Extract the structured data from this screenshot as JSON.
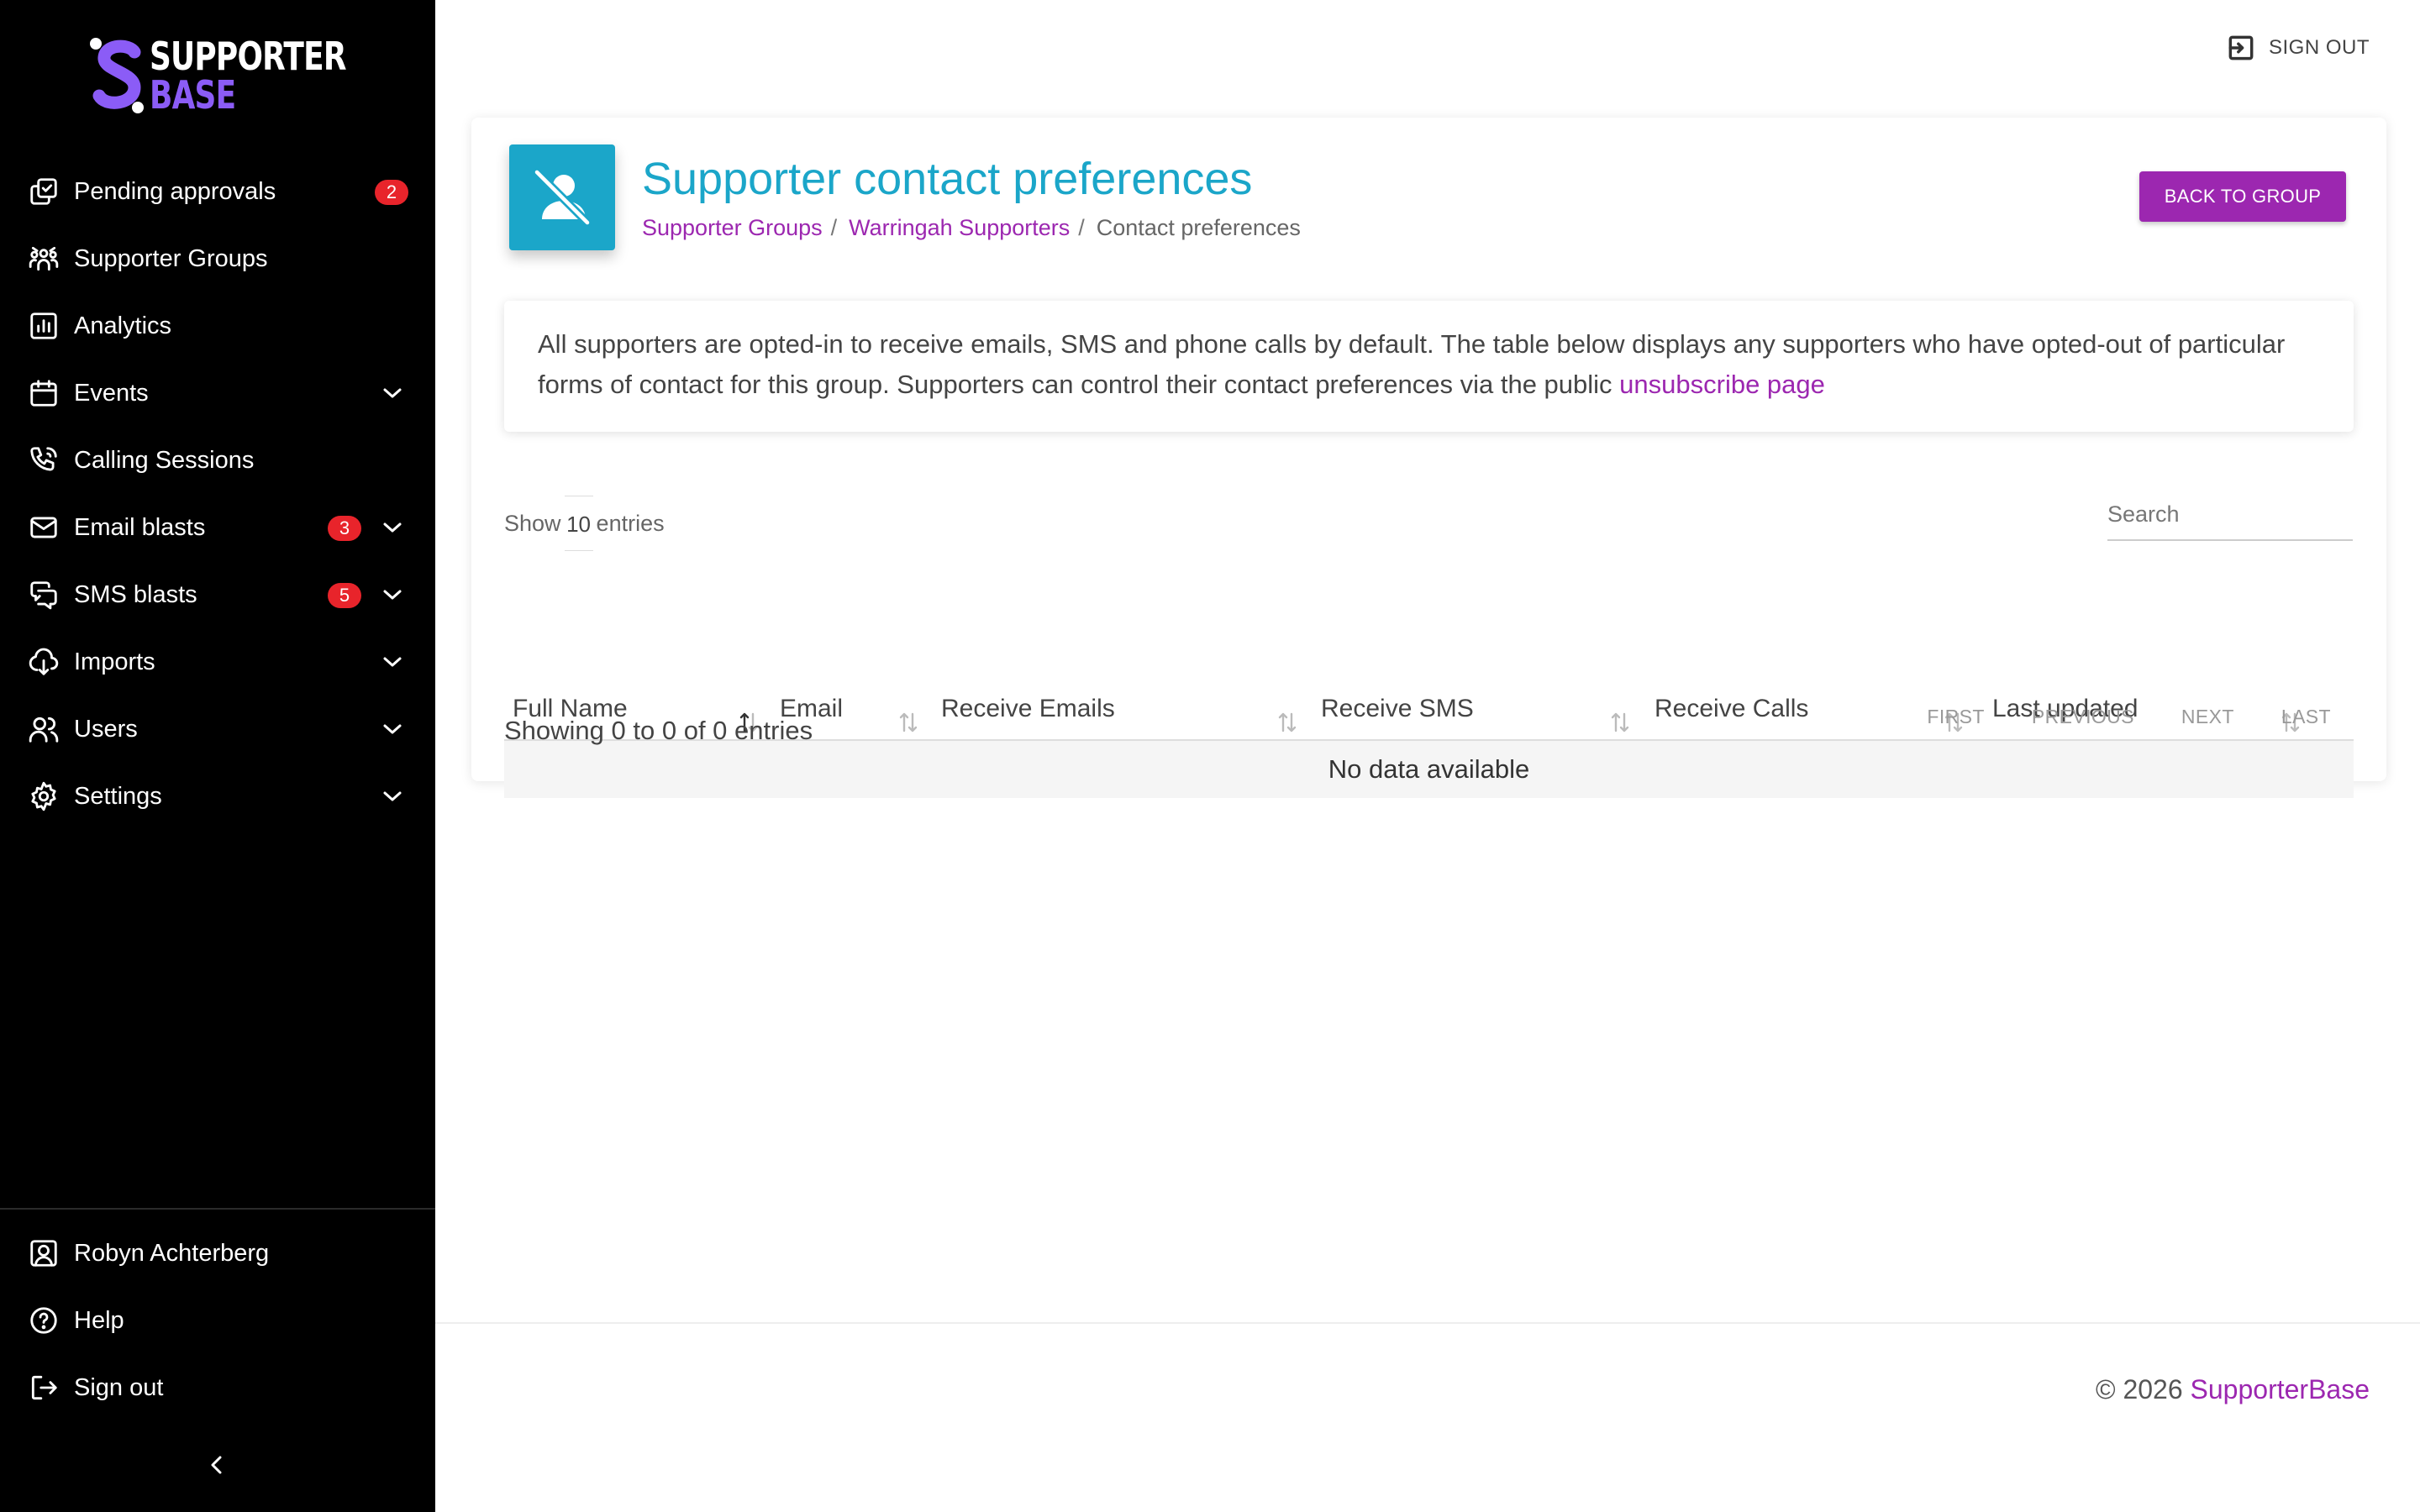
{
  "brand": {
    "line1": "SUPPORTER",
    "line2": "BASE",
    "accent": "#8b5cf6"
  },
  "sidebar": {
    "items": [
      {
        "label": "Pending approvals",
        "icon": "approvals-icon",
        "badge": "2",
        "chevron": false
      },
      {
        "label": "Supporter Groups",
        "icon": "groups-icon",
        "badge": null,
        "chevron": false
      },
      {
        "label": "Analytics",
        "icon": "analytics-icon",
        "badge": null,
        "chevron": false
      },
      {
        "label": "Events",
        "icon": "calendar-icon",
        "badge": null,
        "chevron": true
      },
      {
        "label": "Calling Sessions",
        "icon": "phone-icon",
        "badge": null,
        "chevron": false
      },
      {
        "label": "Email blasts",
        "icon": "mail-icon",
        "badge": "3",
        "chevron": true
      },
      {
        "label": "SMS blasts",
        "icon": "sms-icon",
        "badge": "5",
        "chevron": true
      },
      {
        "label": "Imports",
        "icon": "download-icon",
        "badge": null,
        "chevron": true
      },
      {
        "label": "Users",
        "icon": "users-icon",
        "badge": null,
        "chevron": true
      },
      {
        "label": "Settings",
        "icon": "gear-icon",
        "badge": null,
        "chevron": true
      }
    ],
    "bottom": [
      {
        "label": "Robyn Achterberg",
        "icon": "account-icon"
      },
      {
        "label": "Help",
        "icon": "help-icon"
      },
      {
        "label": "Sign out",
        "icon": "logout-icon"
      }
    ]
  },
  "topbar": {
    "signout_label": "SIGN OUT"
  },
  "page": {
    "title": "Supporter contact preferences",
    "breadcrumb": [
      "Supporter Groups",
      "Warringah Supporters",
      "Contact preferences"
    ],
    "back_button": "BACK TO GROUP",
    "info_text": "All supporters are opted-in to receive emails, SMS and phone calls by default. The table below displays any supporters who have opted-out of particular forms of contact for this group. Supporters can control their contact preferences via the public ",
    "info_link": "unsubscribe page"
  },
  "table": {
    "show_label": "Show",
    "entries_value": "10",
    "entries_label": "entries",
    "search_placeholder": "Search",
    "columns": [
      "Full Name",
      "Email",
      "Receive Emails",
      "Receive SMS",
      "Receive Calls",
      "Last updated"
    ],
    "empty_text": "No data available",
    "showing_text": "Showing 0 to 0 of 0 entries",
    "pager": [
      "FIRST",
      "PREVIOUS",
      "NEXT",
      "LAST"
    ]
  },
  "footer": {
    "copyright": "© 2026",
    "brand_link": "SupporterBase"
  },
  "colors": {
    "primary": "#9c27b0",
    "title": "#1ba6c9",
    "badge": "#e8242b",
    "sidebar_bg": "#000000"
  }
}
